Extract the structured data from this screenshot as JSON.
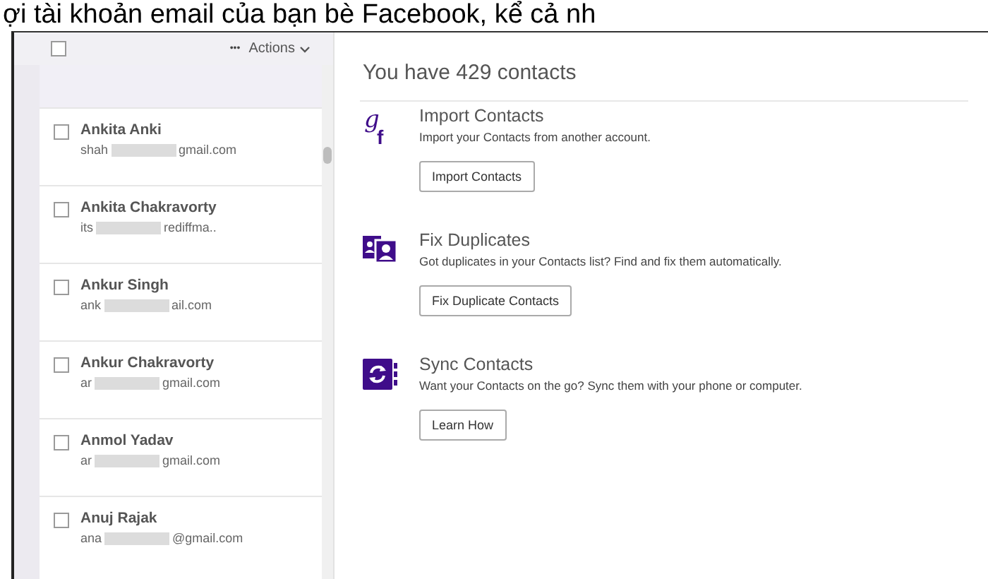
{
  "caption": "ợi tài khoản email của bạn bè Facebook, kể cả nh",
  "toolbar": {
    "select_all": {
      "checked": false
    },
    "actions": {
      "dots": "•••",
      "label": "Actions"
    }
  },
  "contacts": [
    {
      "name": "Ankita Anki",
      "email_start": "shah",
      "email_end": "gmail.com",
      "checked": false
    },
    {
      "name": "Ankita Chakravorty",
      "email_start": "its",
      "email_end": "rediffma..",
      "checked": false
    },
    {
      "name": "Ankur Singh",
      "email_start": "ank",
      "email_end": "ail.com",
      "checked": false
    },
    {
      "name": "Ankur Chakravorty",
      "email_start": "ar",
      "email_end": "gmail.com",
      "checked": false
    },
    {
      "name": "Anmol Yadav",
      "email_start": "ar",
      "email_end": "gmail.com",
      "checked": false
    },
    {
      "name": "Anuj Rajak",
      "email_start": "ana",
      "email_end": "@gmail.com",
      "checked": false
    }
  ],
  "summary": "You have 429 contacts",
  "sections": [
    {
      "kind": "import",
      "icon_letters": [
        "g",
        "f"
      ],
      "title": "Import Contacts",
      "description": "Import your Contacts from another account.",
      "button": "Import Contacts"
    },
    {
      "kind": "duplicates",
      "title": "Fix Duplicates",
      "description": "Got duplicates in your Contacts list? Find and fix them automatically.",
      "button": "Fix Duplicate Contacts"
    },
    {
      "kind": "sync",
      "title": "Sync Contacts",
      "description": "Want your Contacts on the go? Sync them with your phone or computer.",
      "button": "Learn How"
    }
  ]
}
